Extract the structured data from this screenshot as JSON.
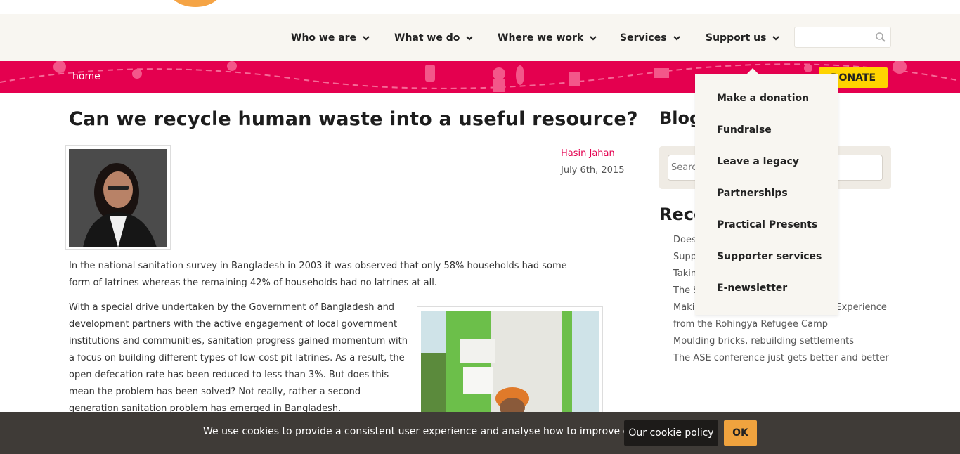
{
  "nav": {
    "items": [
      {
        "label": "Who we are",
        "icon": "chevron-down-icon"
      },
      {
        "label": "What we do",
        "icon": "chevron-down-icon"
      },
      {
        "label": "Where we work",
        "icon": "chevron-down-icon"
      },
      {
        "label": "Services",
        "icon": "chevron-down-icon"
      },
      {
        "label": "Support us",
        "icon": "chevron-down-icon"
      }
    ],
    "search_icon": "search-icon"
  },
  "band": {
    "breadcrumb": "home",
    "donate_label": "DONATE",
    "color": "#e4004f"
  },
  "dropdown": {
    "items": [
      "Make a donation",
      "Fundraise",
      "Leave a legacy",
      "Partnerships",
      "Practical Presents",
      "Supporter services",
      "E-newsletter"
    ]
  },
  "article": {
    "title": "Can we recycle human waste into a useful resource?",
    "author": "Hasin Jahan",
    "date": "July 6th, 2015",
    "para1": "In the national sanitation survey in Bangladesh in 2003 it was observed that only 58% households had some form of latrines whereas the remaining 42% of households had no latrines at all.",
    "para2": "With a special drive undertaken by the Government of Bangladesh and development partners with the active engagement of local government institutions and communities, sanitation progress gained momentum with a focus on building different types of low-cost pit latrines. As a result, the open defecation rate has been reduced to less than 3%. But does this mean the problem has been solved? Not really, rather a second generation sanitation problem has emerged in Bangladesh."
  },
  "sidebar": {
    "blog_heading": "Blog",
    "search_placeholder": "Search",
    "recent_heading": "Recent",
    "recent_items": [
      "Does ... r people's lives?",
      "Supp ... ver effec",
      "Takin ... investment funds",
      "The Solar Challenge",
      "Making Your Work Matter – Sharing Experience from the Rohingya Refugee Camp",
      "Moulding bricks, rebuilding settlements",
      "The ASE conference just gets better and better"
    ]
  },
  "cookie": {
    "text": "We use cookies to provide a consistent user experience and analyse how to improve our sites",
    "policy_label": "Our cookie policy",
    "ok_label": "OK"
  },
  "colors": {
    "accent_pink": "#e4004f",
    "donate_yellow": "#ffd400",
    "ok_orange": "#f0a33e",
    "nav_bg": "#f8f6f1"
  }
}
